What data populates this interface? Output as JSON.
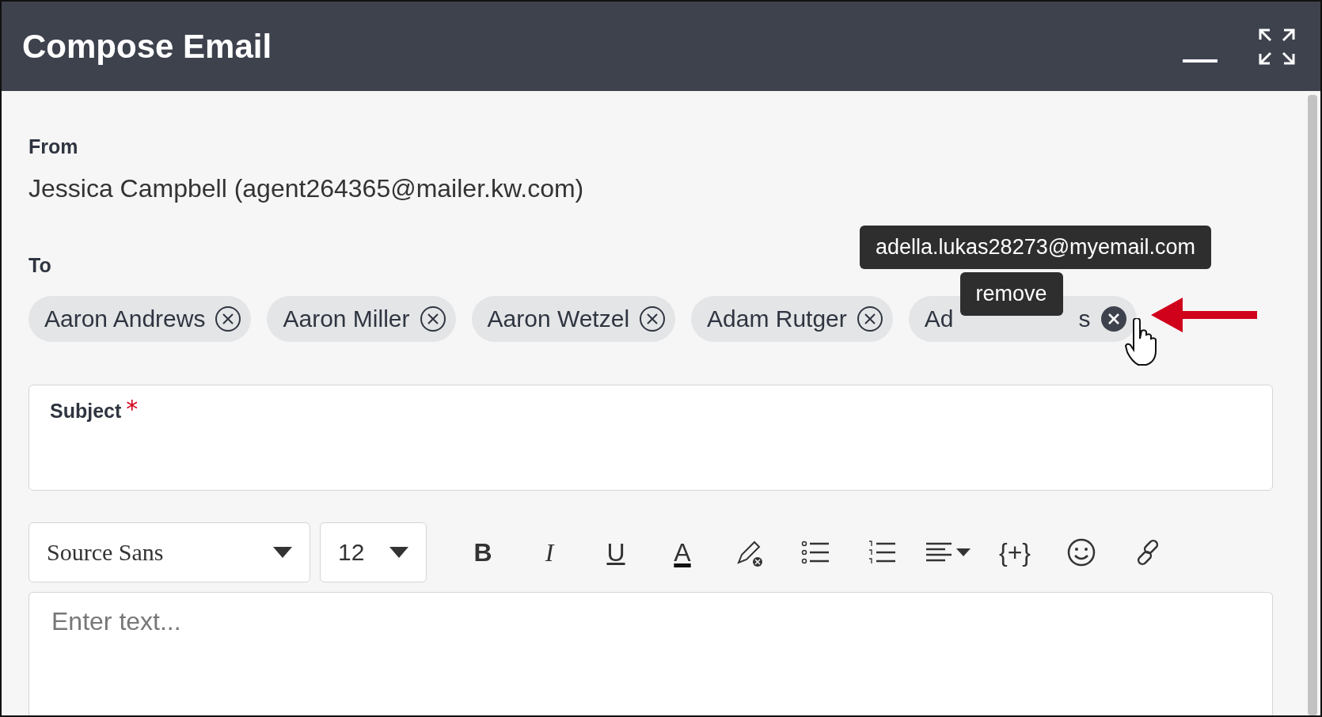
{
  "window": {
    "title": "Compose Email"
  },
  "from": {
    "label": "From",
    "value": "Jessica Campbell (agent264365@mailer.kw.com)"
  },
  "to": {
    "label": "To",
    "recipients": [
      {
        "label_start": "Aaron Andrews",
        "hovered": false
      },
      {
        "label_start": "Aaron Miller",
        "hovered": false
      },
      {
        "label_start": "Aaron Wetzel",
        "hovered": false
      },
      {
        "label_start": "Adam Rutger",
        "hovered": false
      },
      {
        "label_start": "Ad",
        "label_end": "s",
        "hovered": true
      }
    ],
    "email_tooltip": "adella.lukas28273@myemail.com",
    "remove_tooltip": "remove"
  },
  "subject": {
    "label": "Subject",
    "required_mark": "*"
  },
  "toolbar": {
    "font": "Source Sans",
    "size": "12",
    "tools": [
      {
        "kind": "text",
        "label": "B"
      },
      {
        "kind": "text",
        "label": "I"
      },
      {
        "kind": "text",
        "label": "U"
      },
      {
        "kind": "text",
        "label": "A"
      },
      {
        "kind": "highlight"
      },
      {
        "kind": "bullets"
      },
      {
        "kind": "numbers"
      },
      {
        "kind": "align"
      },
      {
        "kind": "text",
        "label": "{+}"
      },
      {
        "kind": "emoji"
      },
      {
        "kind": "link"
      }
    ]
  },
  "editor": {
    "placeholder": "Enter text..."
  }
}
